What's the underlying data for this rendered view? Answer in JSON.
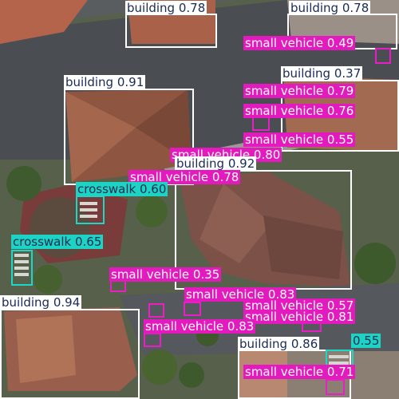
{
  "image": {
    "description_icon": "aerial-photo",
    "colors": {
      "building": "#ffffff",
      "small_vehicle": "#e31bbf",
      "crosswalk": "#1dd4c4"
    }
  },
  "detections": [
    {
      "text": "building 0.78"
    },
    {
      "text": "building 0.78"
    },
    {
      "text": "small vehicle 0.49"
    },
    {
      "text": "building 0.37"
    },
    {
      "text": "small vehicle 0.79"
    },
    {
      "text": "building 0.91"
    },
    {
      "text": "small vehicle 0.76"
    },
    {
      "text": "small vehicle 0.55"
    },
    {
      "text": "small vehicle 0.80"
    },
    {
      "text": "building 0.92"
    },
    {
      "text": "small vehicle 0.78"
    },
    {
      "text": "crosswalk 0.60"
    },
    {
      "text": "crosswalk 0.65"
    },
    {
      "text": "small vehicle 0.35"
    },
    {
      "text": "small vehicle 0.83"
    },
    {
      "text": "small vehicle 0.57"
    },
    {
      "text": "building 0.94"
    },
    {
      "text": "small vehicle 0.81"
    },
    {
      "text": "small vehicle 0.83"
    },
    {
      "text": "building 0.86"
    },
    {
      "text": "0.55"
    },
    {
      "text": "small vehicle 0.71"
    }
  ]
}
